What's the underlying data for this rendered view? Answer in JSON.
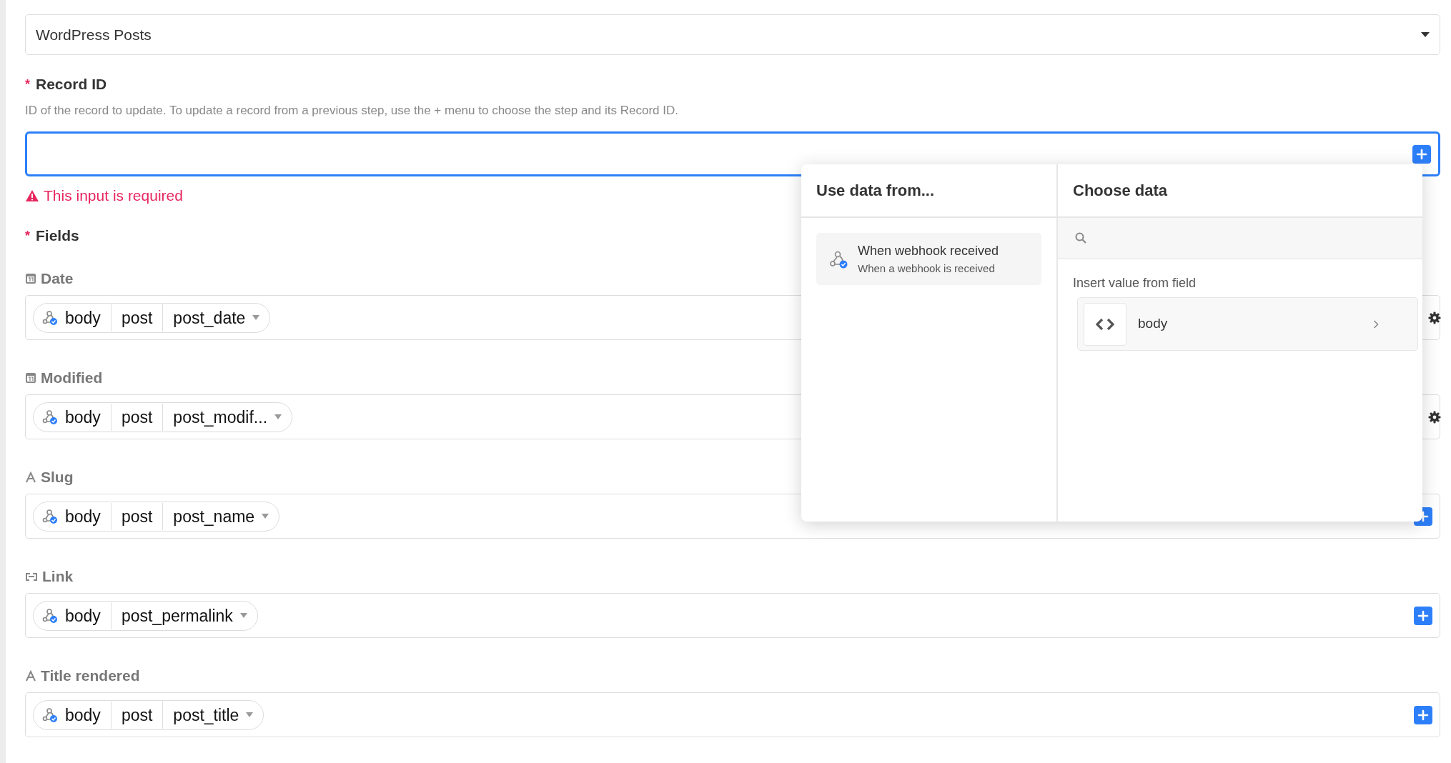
{
  "app_select": {
    "value": "WordPress Posts"
  },
  "record_id": {
    "label": "Record ID",
    "required_mark": "*",
    "help": "ID of the record to update. To update a record from a previous step, use the + menu to choose the step and its Record ID.",
    "focused": true,
    "error": "This input is required"
  },
  "fields_section": {
    "label": "Fields",
    "required_mark": "*"
  },
  "fields": [
    {
      "label": "Date",
      "kind": "date",
      "tokens": [
        "body",
        "post",
        "post_date"
      ],
      "settings": true
    },
    {
      "label": "Modified",
      "kind": "date",
      "tokens": [
        "body",
        "post",
        "post_modif..."
      ],
      "settings": true
    },
    {
      "label": "Slug",
      "kind": "text",
      "tokens": [
        "body",
        "post",
        "post_name"
      ],
      "settings": false
    },
    {
      "label": "Link",
      "kind": "link",
      "tokens": [
        "body",
        "post_permalink"
      ],
      "settings": false
    },
    {
      "label": "Title rendered",
      "kind": "text",
      "tokens": [
        "body",
        "post",
        "post_title"
      ],
      "settings": false
    }
  ],
  "popup": {
    "source_title": "Use data from...",
    "sources": [
      {
        "title": "When webhook received",
        "subtitle": "When a webhook is received"
      }
    ],
    "data_title": "Choose data",
    "section_label": "Insert value from field",
    "items": [
      {
        "label": "body",
        "kind": "object"
      }
    ]
  }
}
